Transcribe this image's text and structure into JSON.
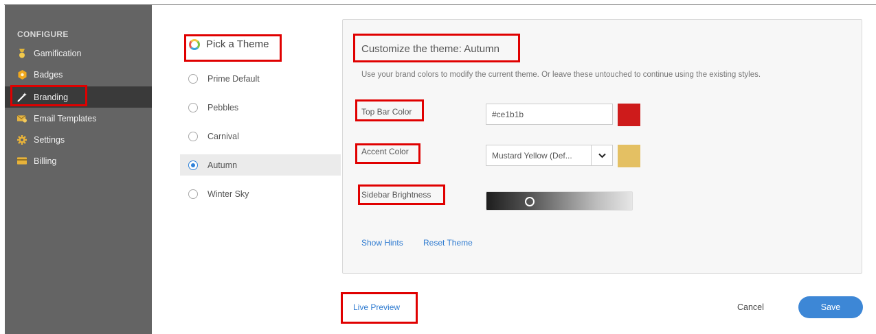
{
  "sidebar": {
    "heading": "CONFIGURE",
    "items": [
      {
        "label": "Gamification",
        "icon": "medal-icon"
      },
      {
        "label": "Badges",
        "icon": "badge-icon"
      },
      {
        "label": "Branding",
        "icon": "magic-wand-icon",
        "active": true
      },
      {
        "label": "Email Templates",
        "icon": "email-icon"
      },
      {
        "label": "Settings",
        "icon": "gear-icon"
      },
      {
        "label": "Billing",
        "icon": "card-icon"
      }
    ]
  },
  "themes": {
    "heading": "Pick a Theme",
    "options": [
      "Prime Default",
      "Pebbles",
      "Carnival",
      "Autumn",
      "Winter Sky"
    ],
    "selected": "Autumn"
  },
  "customize": {
    "title": "Customize the theme: Autumn",
    "description": "Use your brand colors to modify the current theme. Or leave these untouched to continue using the existing styles.",
    "top_bar_label": "Top Bar Color",
    "top_bar_value": "#ce1b1b",
    "top_bar_swatch": "#ce1b1b",
    "accent_label": "Accent Color",
    "accent_value": "Mustard Yellow (Def...",
    "accent_swatch": "#e4c063",
    "brightness_label": "Sidebar Brightness",
    "brightness_level": 0.28,
    "show_hints": "Show Hints",
    "reset_theme": "Reset Theme"
  },
  "footer": {
    "live_preview": "Live Preview",
    "cancel": "Cancel",
    "save": "Save"
  }
}
